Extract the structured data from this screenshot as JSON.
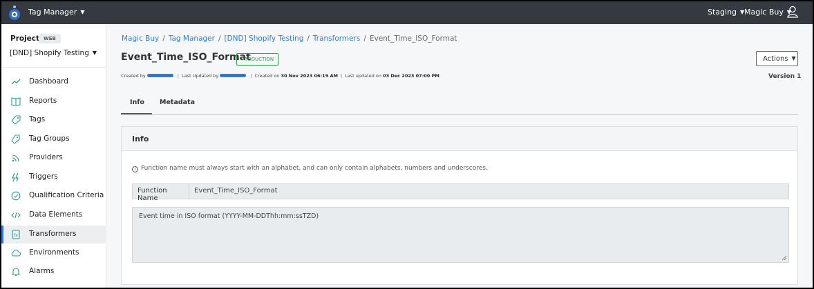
{
  "topbar": {
    "app_name": "Tag Manager",
    "environment": "Staging",
    "organization": "Magic Buy",
    "logo_icon": "tag-manager-logo",
    "user_icon": "user-icon"
  },
  "sidebar": {
    "project_label": "Project",
    "platform_badge": "WEB",
    "project_name": "[DND] Shopify Testing",
    "items": [
      {
        "label": "Dashboard",
        "icon": "line-chart-icon"
      },
      {
        "label": "Reports",
        "icon": "book-icon"
      },
      {
        "label": "Tags",
        "icon": "tag-icon"
      },
      {
        "label": "Tag Groups",
        "icon": "tags-icon"
      },
      {
        "label": "Providers",
        "icon": "signal-icon"
      },
      {
        "label": "Triggers",
        "icon": "lightning-icon"
      },
      {
        "label": "Qualification Criteria",
        "icon": "check-circle-icon"
      },
      {
        "label": "Data Elements",
        "icon": "code-icon"
      },
      {
        "label": "Transformers",
        "icon": "transform-icon",
        "active": true
      },
      {
        "label": "Environments",
        "icon": "cloud-icon"
      },
      {
        "label": "Alarms",
        "icon": "bell-icon"
      }
    ]
  },
  "breadcrumb": {
    "items": [
      "Magic Buy",
      "Tag Manager",
      "[DND] Shopify Testing",
      "Transformers"
    ],
    "current": "Event_Time_ISO_Format"
  },
  "header": {
    "title": "Event_Time_ISO_Format",
    "status_badge": "PRODUCTION",
    "actions_label": "Actions",
    "version": "Version 1"
  },
  "meta": {
    "created_by_label": "Created by",
    "last_updated_by_label": "Last Updated by",
    "created_on_label": "Created on",
    "created_on": "30 Nov 2023 06:19 AM",
    "last_updated_on_label": "Last updated on",
    "last_updated_on": "03 Dec 2023 07:00 PM"
  },
  "tabs": [
    {
      "label": "Info",
      "active": true
    },
    {
      "label": "Metadata",
      "active": false
    }
  ],
  "info_panel": {
    "heading": "Info",
    "hint": "Function name must always start with an alphabet, and can only contain alphabets, numbers and underscores.",
    "function_name_label": "Function Name",
    "function_name_value": "Event_Time_ISO_Format",
    "description": "Event time in ISO format (YYYY-MM-DDThh:mm:ssTZD)"
  },
  "colors": {
    "topbar": "#343a40",
    "link": "#2c7be5",
    "production": "#28a745"
  }
}
